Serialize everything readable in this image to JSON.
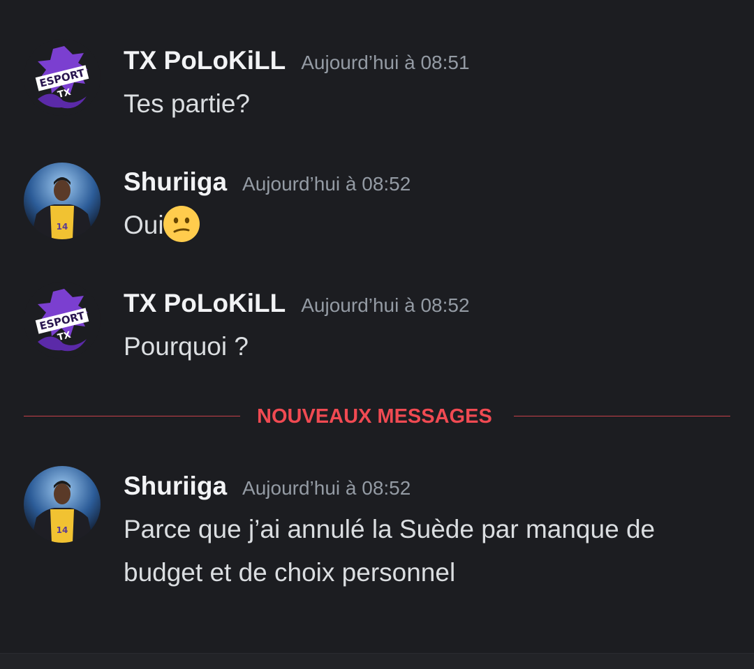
{
  "messages": [
    {
      "author": "TX PoLoKiLL",
      "timestamp": "Aujourd’hui à 08:51",
      "content": "Tes partie?",
      "avatar": "esport-dragon-logo"
    },
    {
      "author": "Shuriiga",
      "timestamp": "Aujourd’hui à 08:52",
      "content": "Oui",
      "emoji": "confused-face",
      "avatar": "basketball-player-avatar"
    },
    {
      "author": "TX PoLoKiLL",
      "timestamp": "Aujourd’hui à 08:52",
      "content": "Pourquoi ?",
      "avatar": "esport-dragon-logo"
    },
    {
      "author": "Shuriiga",
      "timestamp": "Aujourd’hui à 08:52",
      "content": "Parce que j’ai annulé la Suède par manque de budget et de choix personnel",
      "avatar": "basketball-player-avatar"
    }
  ],
  "divider": {
    "label": "NOUVEAUX MESSAGES",
    "color": "#f04a52"
  },
  "colors": {
    "background": "#1c1d21",
    "author": "#f2f3f5",
    "timestamp": "#949ba4",
    "content": "#dbdee1"
  }
}
